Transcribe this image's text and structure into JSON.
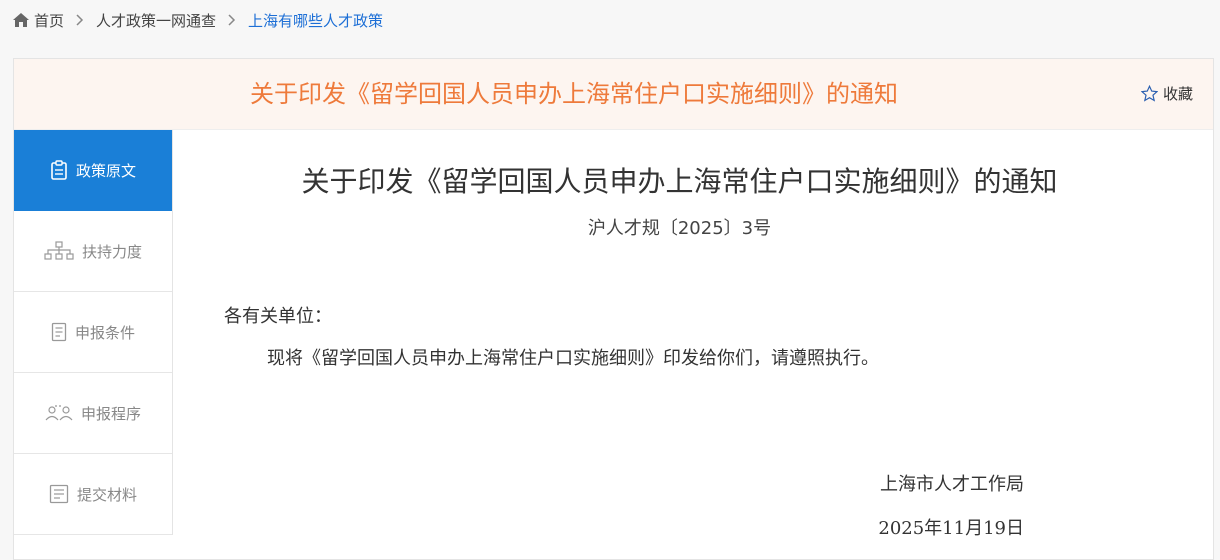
{
  "breadcrumb": {
    "items": [
      {
        "label": "首页"
      },
      {
        "label": "人才政策一网通查"
      },
      {
        "label": "上海有哪些人才政策"
      }
    ]
  },
  "header": {
    "title": "关于印发《留学回国人员申办上海常住户口实施细则》的通知",
    "favorite_label": "收藏",
    "title_color": "#ee7a3b"
  },
  "sidebar": {
    "items": [
      {
        "label": "政策原文",
        "icon": "clipboard-icon",
        "active": true
      },
      {
        "label": "扶持力度",
        "icon": "hierarchy-icon",
        "active": false
      },
      {
        "label": "申报条件",
        "icon": "document-icon",
        "active": false
      },
      {
        "label": "申报程序",
        "icon": "people-icon",
        "active": false
      },
      {
        "label": "提交材料",
        "icon": "form-icon",
        "active": false
      }
    ],
    "active_color": "#1a7fd7"
  },
  "document": {
    "title": "关于印发《留学回国人员申办上海常住户口实施细则》的通知",
    "number": "沪人才规〔2025〕3号",
    "salutation": "各有关单位：",
    "body": "现将《留学回国人员申办上海常住户口实施细则》印发给你们，请遵照执行。",
    "issuer": "上海市人才工作局",
    "date": "2025年11月19日"
  }
}
